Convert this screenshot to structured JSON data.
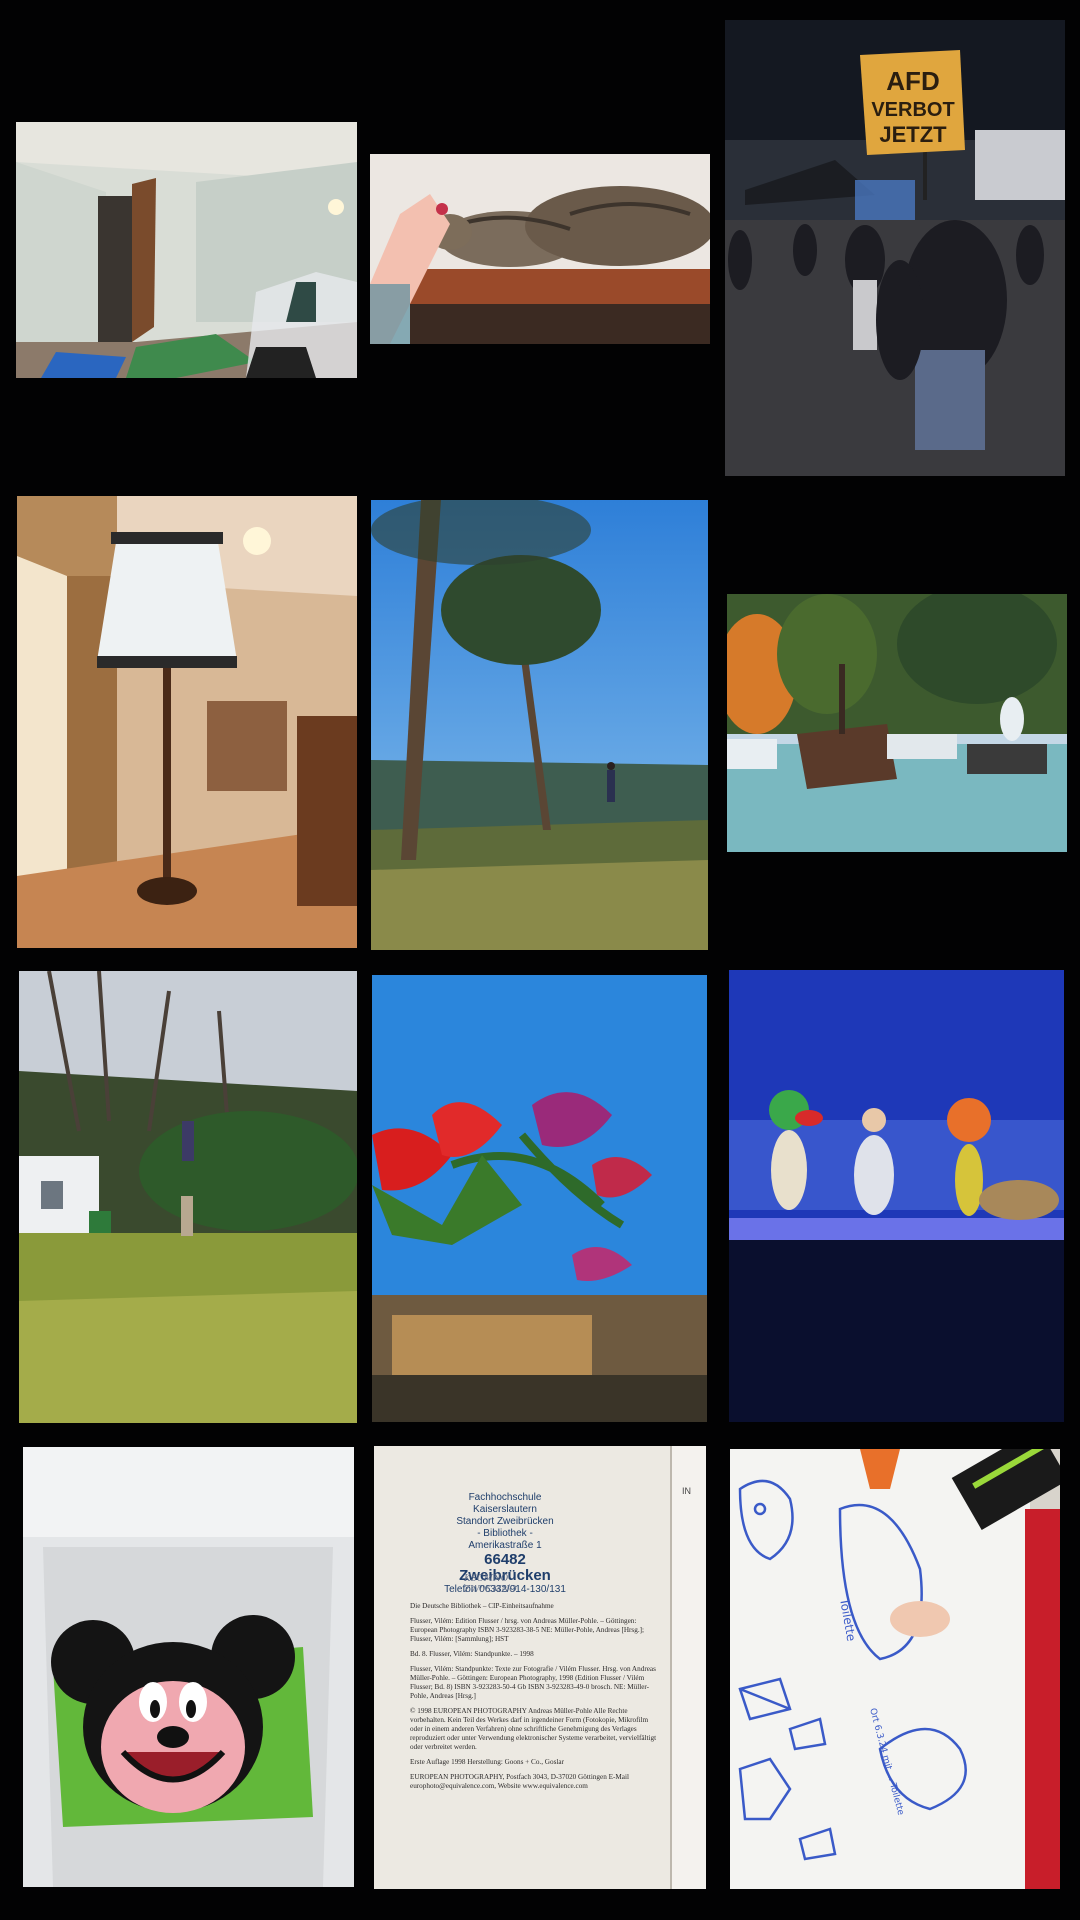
{
  "collage": {
    "background_color": "#020203",
    "tiles": [
      {
        "id": "room-doorway",
        "subject": "empty-room-with-open-door"
      },
      {
        "id": "sleeping-cat",
        "subject": "tabby-cat-on-shelf"
      },
      {
        "id": "protest-sign",
        "subject": "night-demonstration",
        "sign": {
          "line1": "AFD",
          "line2": "VERBOT",
          "line3": "JETZT"
        }
      },
      {
        "id": "floor-lamp",
        "subject": "lamp-in-empty-room"
      },
      {
        "id": "tall-pines",
        "subject": "pines-over-valley"
      },
      {
        "id": "park-ship",
        "subject": "viking-ship-ride"
      },
      {
        "id": "garden-lawn",
        "subject": "winter-garden"
      },
      {
        "id": "giant-flowers",
        "subject": "oversized-flower-sculptures"
      },
      {
        "id": "stage-show",
        "subject": "costumed-characters-on-stage"
      },
      {
        "id": "mouse-cake",
        "subject": "cartoon-mouse-cake"
      },
      {
        "id": "book-page",
        "subject": "library-stamped-book-page"
      },
      {
        "id": "child-drawing",
        "subject": "child-drawing-on-whiteboard"
      }
    ]
  },
  "book": {
    "stamp": {
      "line1": "Fachhochschule Kaiserslautern",
      "line2": "Standort Zweibrücken",
      "line3": "- Bibliothek -",
      "line4": "Amerikastraße 1",
      "line5": "66482 Zweibrücken",
      "line6": "Telefon 06332/914-130/131"
    },
    "handwriting": {
      "line1": "KSCMNO",
      "line2": "ZW0CMNO"
    },
    "cip": [
      "Die Deutsche Bibliothek – CIP-Einheitsaufnahme",
      "Flusser, Vilém: Edition Flusser / hrsg. von Andreas Müller-Pohle. – Göttingen: European Photography ISBN 3-923283-38-5 NE: Müller-Pohle, Andreas [Hrsg.]; Flusser, Vilém: [Sammlung]; HST",
      "Bd. 8. Flusser, Vilém: Standpunkte. – 1998",
      "Flusser, Vilém: Standpunkte: Texte zur Fotografie / Vilém Flusser. Hrsg. von Andreas Müller-Pohle. – Göttingen: European Photography, 1998 (Edition Flusser / Vilém Flusser; Bd. 8) ISBN 3-923283-50-4 Gb ISBN 3-923283-49-0 brosch. NE: Müller-Pohle, Andreas [Hrsg.]",
      "© 1998 EUROPEAN PHOTOGRAPHY Andreas Müller-Pohle Alle Rechte vorbehalten. Kein Teil des Werkes darf in irgendeiner Form (Fotokopie, Mikrofilm oder in einem anderen Verfahren) ohne schriftliche Genehmigung des Verlages reproduziert oder unter Verwendung elektronischer Systeme verarbeitet, vervielfältigt oder verbreitet werden.",
      "Erste Auflage 1998 Herstellung: Goons + Co., Goslar",
      "EUROPEAN PHOTOGRAPHY, Postfach 3043, D-37020 Göttingen E-Mail europhoto@equivalence.com, Website www.equivalence.com"
    ],
    "gutter_text": "IN"
  },
  "drawing": {
    "scribble1": "Toilette",
    "scribble2": "Ort 6.3.24 mit ... Toilette"
  }
}
